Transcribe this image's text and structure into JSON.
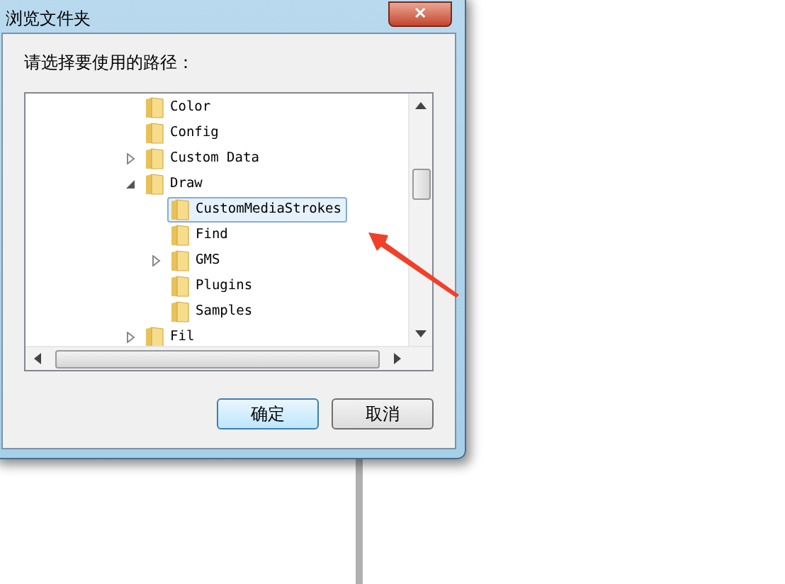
{
  "window": {
    "title": "浏览文件夹",
    "close_button": "✕"
  },
  "prompt": "请选择要使用的路径：",
  "tree": [
    {
      "label": "Color",
      "kind": "leaf",
      "selected": false
    },
    {
      "label": "Config",
      "kind": "leaf",
      "selected": false
    },
    {
      "label": "Custom Data",
      "kind": "branch",
      "expanded": false,
      "selected": false
    },
    {
      "label": "Draw",
      "kind": "branch",
      "expanded": true,
      "selected": false,
      "children": [
        {
          "label": "CustomMediaStrokes",
          "kind": "leaf",
          "selected": true
        },
        {
          "label": "Find",
          "kind": "leaf",
          "selected": false
        },
        {
          "label": "GMS",
          "kind": "branch",
          "expanded": false,
          "selected": false
        },
        {
          "label": "Plugins",
          "kind": "leaf",
          "selected": false
        },
        {
          "label": "Samples",
          "kind": "leaf",
          "selected": false
        }
      ]
    },
    {
      "label": "Fil",
      "kind": "branch",
      "expanded": false,
      "selected": false
    }
  ],
  "buttons": [
    {
      "label": "确定",
      "default": true
    },
    {
      "label": "取消",
      "default": false
    }
  ]
}
